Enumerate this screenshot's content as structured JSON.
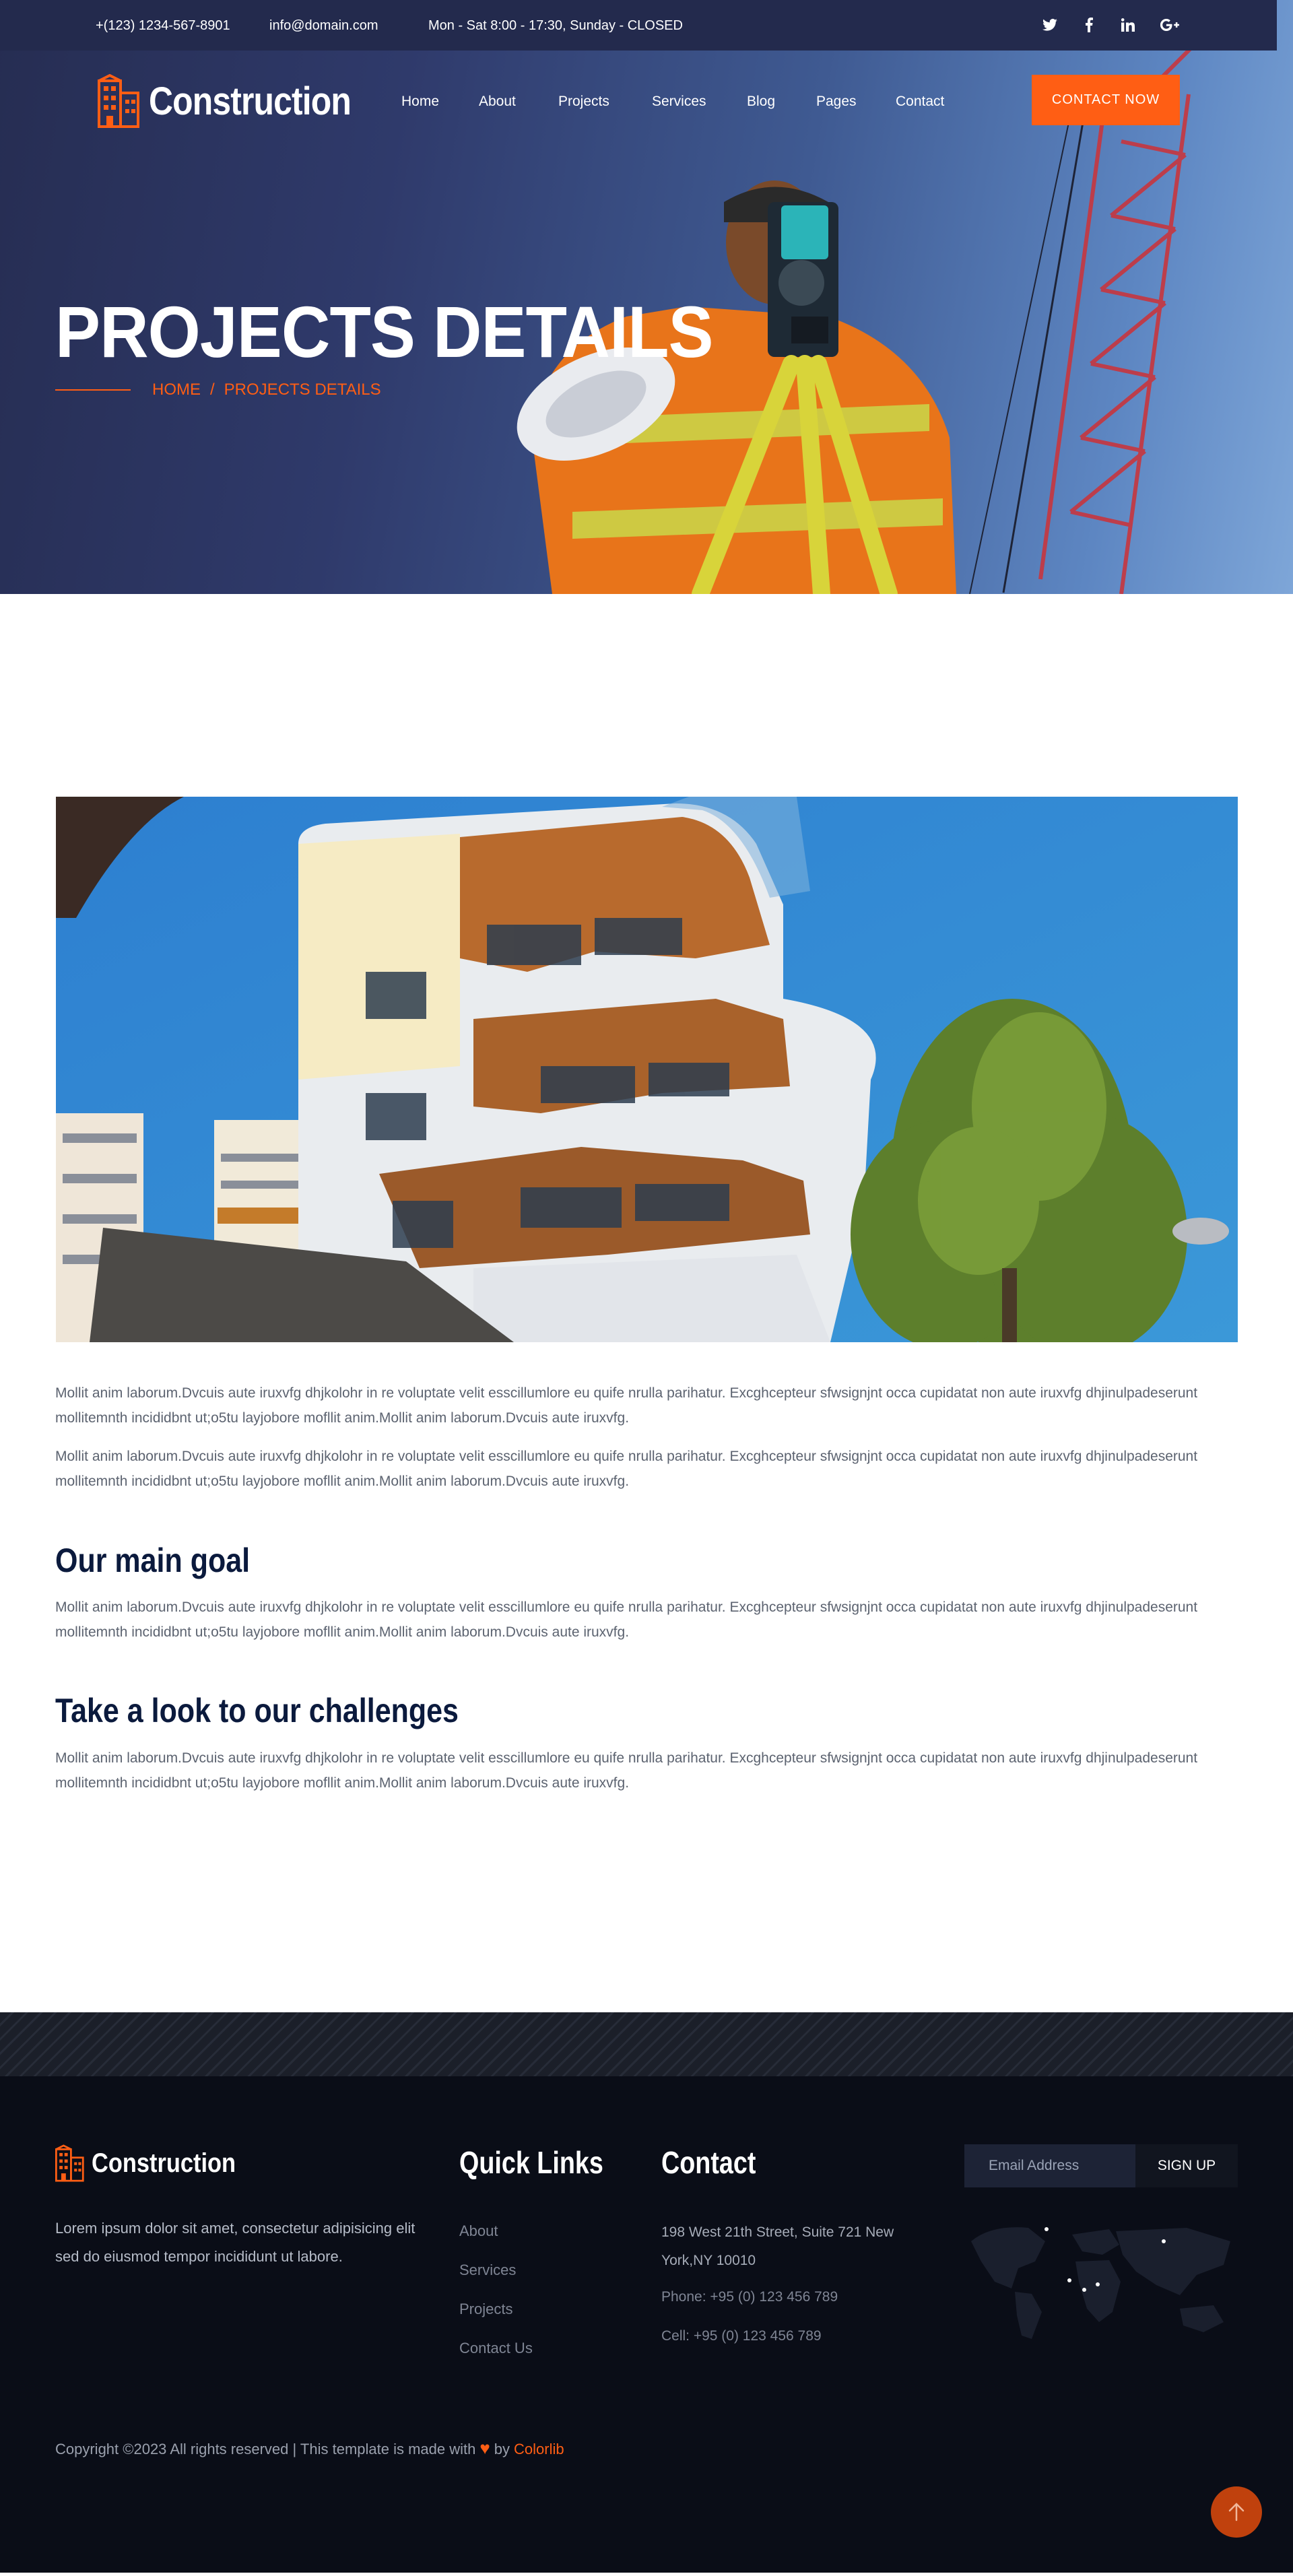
{
  "topbar": {
    "phone": "+(123) 1234-567-8901",
    "email": "info@domain.com",
    "hours": "Mon - Sat 8:00 - 17:30, Sunday - CLOSED",
    "social": [
      "twitter-icon",
      "facebook-icon",
      "linkedin-icon",
      "google-plus-icon"
    ]
  },
  "header": {
    "brand": "Construction",
    "nav": [
      "Home",
      "About",
      "Projects",
      "Services",
      "Blog",
      "Pages",
      "Contact"
    ],
    "cta": "CONTACT NOW"
  },
  "hero": {
    "title": "PROJECTS DETAILS",
    "breadcrumb": [
      "HOME",
      "PROJECTS DETAILS"
    ],
    "separator": "/"
  },
  "content": {
    "intro": [
      "Mollit anim laborum.Dvcuis aute iruxvfg dhjkolohr in re voluptate velit esscillumlore eu quife nrulla parihatur. Excghcepteur sfwsignjnt occa cupidatat non aute iruxvfg dhjinulpadeserunt mollitemnth incididbnt ut;o5tu layjobore mofllit anim.Mollit anim laborum.Dvcuis aute iruxvfg.",
      "Mollit anim laborum.Dvcuis aute iruxvfg dhjkolohr in re voluptate velit esscillumlore eu quife nrulla parihatur. Excghcepteur sfwsignjnt occa cupidatat non aute iruxvfg dhjinulpadeserunt mollitemnth incididbnt ut;o5tu layjobore mofllit anim.Mollit anim laborum.Dvcuis aute iruxvfg."
    ],
    "goal": {
      "title": "Our main goal",
      "text": "Mollit anim laborum.Dvcuis aute iruxvfg dhjkolohr in re voluptate velit esscillumlore eu quife nrulla parihatur. Excghcepteur sfwsignjnt occa cupidatat non aute iruxvfg dhjinulpadeserunt mollitemnth incididbnt ut;o5tu layjobore mofllit anim.Mollit anim laborum.Dvcuis aute iruxvfg."
    },
    "challenges": {
      "title": "Take a look to our challenges",
      "text": "Mollit anim laborum.Dvcuis aute iruxvfg dhjkolohr in re voluptate velit esscillumlore eu quife nrulla parihatur. Excghcepteur sfwsignjnt occa cupidatat non aute iruxvfg dhjinulpadeserunt mollitemnth incididbnt ut;o5tu layjobore mofllit anim.Mollit anim laborum.Dvcuis aute iruxvfg."
    }
  },
  "footer": {
    "brand": "Construction",
    "about": "Lorem ipsum dolor sit amet, consectetur adipisicing elit sed do eiusmod tempor incididunt ut labore.",
    "quick_links_title": "Quick Links",
    "quick_links": [
      "About",
      "Services",
      "Projects",
      "Contact Us"
    ],
    "contact_title": "Contact",
    "address_line1": "198 West 21th Street, Suite 721 New",
    "address_line2": "York,NY 10010",
    "phone": "Phone: +95 (0) 123 456 789",
    "cell": "Cell: +95 (0) 123 456 789",
    "newsletter_placeholder": "Email Address",
    "newsletter_button": "SIGN UP",
    "copyright_text": "Copyright ©2023 All rights reserved | This template is made with",
    "copyright_by": "by",
    "copyright_link": "Colorlib"
  },
  "colors": {
    "accent": "#ff5e14",
    "navy": "#0b1a3d",
    "topbar": "#232a4d",
    "footer_bg": "#0a0d17"
  }
}
